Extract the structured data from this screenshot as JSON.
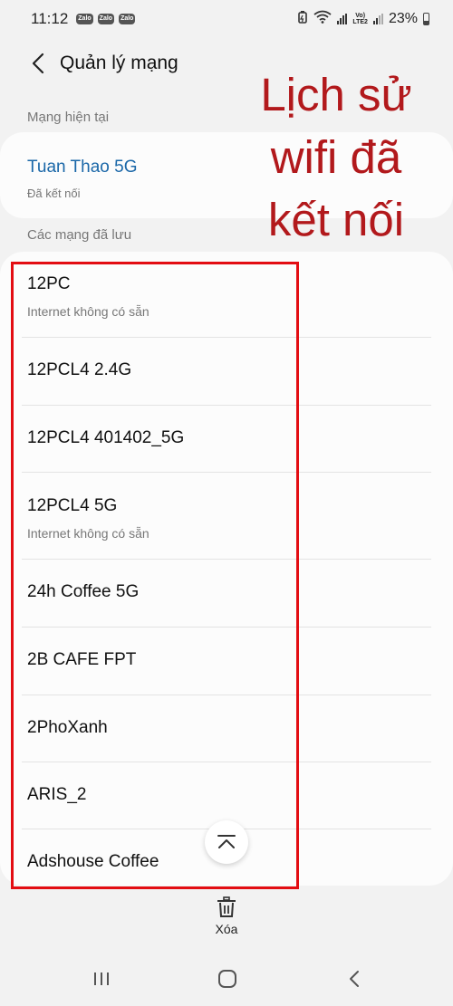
{
  "status_bar": {
    "time": "11:12",
    "apps": [
      "Zalo",
      "Zalo",
      "Zalo"
    ],
    "lte_label": "Vo)\nLTE2",
    "battery": "23%"
  },
  "header": {
    "title": "Quản lý mạng"
  },
  "current_section": {
    "label": "Mạng hiện tại",
    "network_name": "Tuan Thao 5G",
    "network_status": "Đã kết nối"
  },
  "saved_section": {
    "label": "Các mạng đã lưu",
    "networks": [
      {
        "name": "12PC",
        "sub": "Internet không có sẵn"
      },
      {
        "name": "12PCL4 2.4G",
        "sub": ""
      },
      {
        "name": "12PCL4 401402_5G",
        "sub": ""
      },
      {
        "name": "12PCL4 5G",
        "sub": "Internet không có sẵn"
      },
      {
        "name": "24h Coffee 5G",
        "sub": ""
      },
      {
        "name": "2B CAFE FPT",
        "sub": ""
      },
      {
        "name": "2PhoXanh",
        "sub": ""
      },
      {
        "name": "ARIS_2",
        "sub": ""
      },
      {
        "name": "Adshouse Coffee",
        "sub": ""
      }
    ]
  },
  "annotation": {
    "text": "Lịch sử wifi đã kết nối",
    "color": "#b2191c"
  },
  "bottom_action": {
    "label": "Xóa"
  },
  "colors": {
    "accent": "#1a67a8",
    "highlight": "#e30d12"
  }
}
